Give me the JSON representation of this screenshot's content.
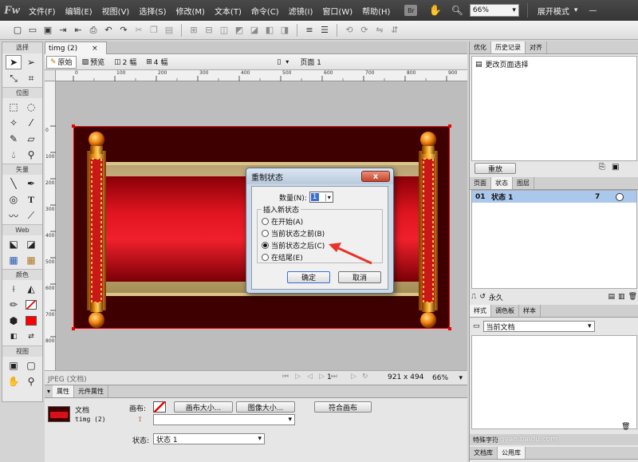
{
  "app": {
    "logo": "Fw"
  },
  "menubar": {
    "items": [
      "文件(F)",
      "编辑(E)",
      "视图(V)",
      "选择(S)",
      "修改(M)",
      "文本(T)",
      "命令(C)",
      "滤镜(I)",
      "窗口(W)",
      "帮助(H)"
    ],
    "zoom": "66%",
    "workspace": "展开模式"
  },
  "tools": {
    "sections": [
      "选择",
      "位图",
      "矢量",
      "Web",
      "颜色",
      "视图"
    ]
  },
  "document": {
    "tab": "timg (2)",
    "close": "×",
    "page_label": "页面 1"
  },
  "viewbar": {
    "original": "原始",
    "preview": "预览",
    "two_up": "2 幅",
    "four_up": "4 幅"
  },
  "ruler": {
    "h_labels": [
      "0",
      "100",
      "200",
      "300",
      "400",
      "500",
      "600",
      "700",
      "800",
      "900"
    ],
    "v_labels": [
      "0",
      "100",
      "200",
      "300",
      "400",
      "500",
      "600",
      "700",
      "800"
    ]
  },
  "status": {
    "file_type": "JPEG (文档)",
    "page_num": "1",
    "size": "921 x 494",
    "zoom": "66%"
  },
  "dialog": {
    "title": "重制状态",
    "close": "x",
    "count_label": "数量(N):",
    "count_value": "1",
    "group_label": "插入新状态",
    "options": [
      "在开始(A)",
      "当前状态之前(B)",
      "当前状态之后(C)",
      "在结尾(E)"
    ],
    "selected_index": 2,
    "ok": "确定",
    "cancel": "取消"
  },
  "history": {
    "tabs": [
      "优化",
      "历史记录",
      "对齐"
    ],
    "item": "更改页面选择",
    "replay": "重放"
  },
  "states": {
    "tabs": [
      "页面",
      "状态",
      "图层"
    ],
    "row_num": "01",
    "row_name": "状态 1",
    "row_delay": "7",
    "footer_label": "永久"
  },
  "styles": {
    "tabs": [
      "样式",
      "调色板",
      "样本"
    ],
    "select": "当前文档"
  },
  "properties": {
    "tabs": [
      "属性",
      "元件属性"
    ],
    "doc_label": "文档",
    "doc_name": "timg (2)",
    "canvas_label": "画布:",
    "canvas_size_btn": "画布大小...",
    "image_size_btn": "图像大小...",
    "fit_canvas_btn": "符合画布",
    "state_label": "状态:",
    "state_value": "状态 1"
  },
  "bottom_tabs": {
    "special": "特殊字符",
    "doc_lib": "文档库",
    "common_lib": "公用库"
  },
  "watermark": {
    "site": "jingyan.baidu.com"
  },
  "colors": {
    "menubar": "#3c3c3c",
    "canvas": "#bdbdbd",
    "scroll_red": "#d8101a",
    "arrow": "#e8332a",
    "selection": "#a9c8ec"
  }
}
